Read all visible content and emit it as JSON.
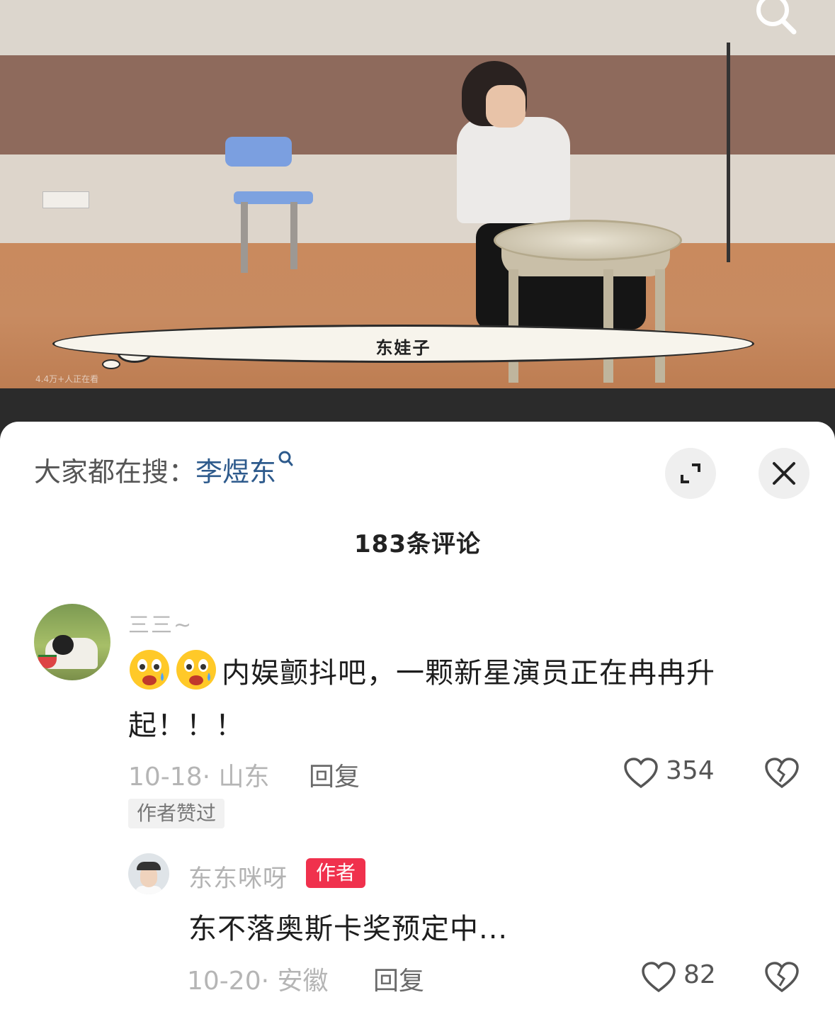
{
  "video": {
    "subtitle": "东娃子",
    "viewer_count": "4.4万+人正在看"
  },
  "header": {
    "hot_search_prefix": "大家都在搜：",
    "hot_search_keyword": "李煜东",
    "comment_count": "183条评论"
  },
  "comments": [
    {
      "username": "三三~",
      "emojis": [
        "crying-face-emoji",
        "crying-face-emoji"
      ],
      "text": "内娱颤抖吧，一颗新星演员正在冉冉升起！！！",
      "date_location": "10-18· 山东",
      "reply_label": "回复",
      "likes": "354",
      "badge": "作者赞过"
    },
    {
      "username": "东东咪呀",
      "author_tag": "作者",
      "text": "东不落奥斯卡奖预定中...",
      "date_location": "10-20· 安徽",
      "reply_label": "回复",
      "likes": "82"
    }
  ],
  "colors": {
    "keyword": "#2d5a8c",
    "author_tag": "#f0314d",
    "sheet_bg": "#ffffff"
  }
}
